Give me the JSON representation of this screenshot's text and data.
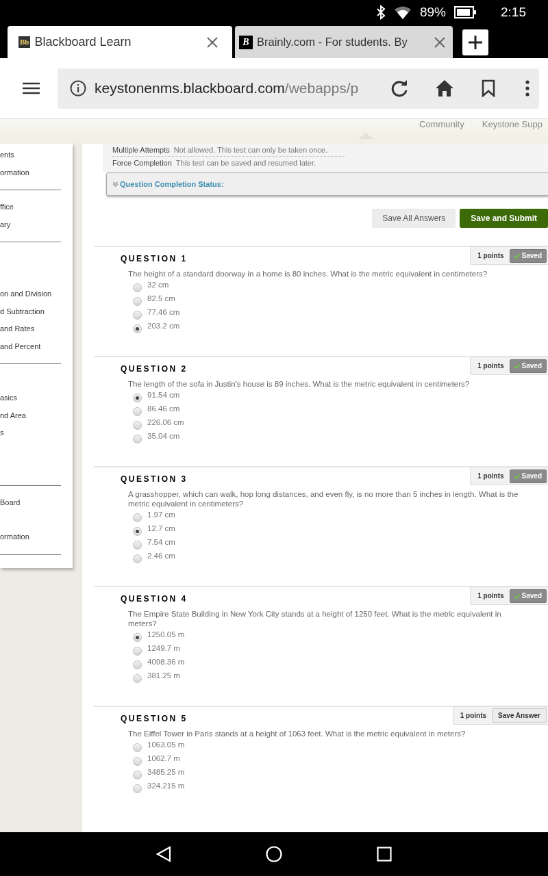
{
  "status_bar": {
    "battery": "89%",
    "time": "2:15"
  },
  "browser_tabs": [
    {
      "title": "Blackboard Learn",
      "icon": "Bb",
      "selected": true
    },
    {
      "title": "Brainly.com - For students. By",
      "icon": "B",
      "selected": false
    }
  ],
  "address_bar": {
    "domain": "keystonenms.blackboard.com",
    "path": "/webapps/p"
  },
  "top_nav": [
    "Community",
    "Keystone Supp"
  ],
  "sidebar": {
    "sections": [
      {
        "items": [
          "ents",
          "ormation"
        ]
      },
      {
        "items": [
          "ffice",
          "ary"
        ]
      },
      {
        "items": [
          "on and Division",
          "d Subtraction",
          "and Rates",
          "and Percent"
        ]
      },
      {
        "items": [
          "asics",
          "nd Area",
          "s"
        ]
      },
      {
        "items": [
          "Board",
          "ormation"
        ]
      }
    ]
  },
  "test_info": [
    {
      "label": "Multiple Attempts",
      "value": "Not allowed. This test can only be taken once."
    },
    {
      "label": "Force Completion",
      "value": "This test can be saved and resumed later."
    }
  ],
  "completion_status": {
    "label": "Question Completion Status:",
    "expanded": false
  },
  "actions": [
    "Save All Answers",
    "Save and Submit"
  ],
  "questions": [
    {
      "title": "QUESTION 1",
      "points": "1 points",
      "saved": true,
      "status": "Saved",
      "prompt": "The height of a standard doorway in a home is 80 inches. What is the metric equivalent in centimeters?",
      "options": [
        {
          "label": "32 cm",
          "selected": false
        },
        {
          "label": "82.5 cm",
          "selected": false
        },
        {
          "label": "77.46 cm",
          "selected": false
        },
        {
          "label": "203.2 cm",
          "selected": true
        }
      ]
    },
    {
      "title": "QUESTION 2",
      "points": "1 points",
      "saved": true,
      "status": "Saved",
      "prompt": "The length of the sofa in Justin's house is 89 inches. What is the metric equivalent in centimeters?",
      "options": [
        {
          "label": "91.54 cm",
          "selected": true
        },
        {
          "label": "86.46 cm",
          "selected": false
        },
        {
          "label": "226.06 cm",
          "selected": false
        },
        {
          "label": "35.04 cm",
          "selected": false
        }
      ]
    },
    {
      "title": "QUESTION 3",
      "points": "1 points",
      "saved": true,
      "status": "Saved",
      "prompt": "A grasshopper, which can walk, hop long distances, and even fly, is no more than 5 inches in length. What is the metric equivalent in centimeters?",
      "options": [
        {
          "label": "1.97 cm",
          "selected": false
        },
        {
          "label": "12.7 cm",
          "selected": true
        },
        {
          "label": "7.54 cm",
          "selected": false
        },
        {
          "label": "2.46 cm",
          "selected": false
        }
      ]
    },
    {
      "title": "QUESTION 4",
      "points": "1 points",
      "saved": true,
      "status": "Saved",
      "prompt": "The Empire State Building in New York City stands at a height of 1250 feet. What is the metric equivalent in meters?",
      "options": [
        {
          "label": "1250.05 m",
          "selected": true
        },
        {
          "label": "1249.7 m",
          "selected": false
        },
        {
          "label": "4098.36 m",
          "selected": false
        },
        {
          "label": "381.25 m",
          "selected": false
        }
      ]
    },
    {
      "title": "QUESTION 5",
      "points": "1 points",
      "saved": false,
      "status": "Save Answer",
      "prompt": "The Eiffel Tower in Paris stands at a height of 1063 feet. What is the metric equivalent in meters?",
      "options": [
        {
          "label": "1063.05 m",
          "selected": false
        },
        {
          "label": "1062.7 m",
          "selected": false
        },
        {
          "label": "3485.25 m",
          "selected": false
        },
        {
          "label": "324.215 m",
          "selected": false
        }
      ]
    }
  ]
}
